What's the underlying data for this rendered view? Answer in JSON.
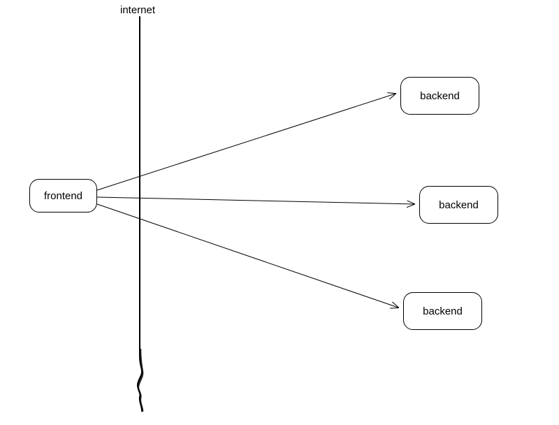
{
  "labels": {
    "internet": "internet"
  },
  "nodes": {
    "frontend": "frontend",
    "backend1": "backend",
    "backend2": "backend",
    "backend3": "backend"
  }
}
